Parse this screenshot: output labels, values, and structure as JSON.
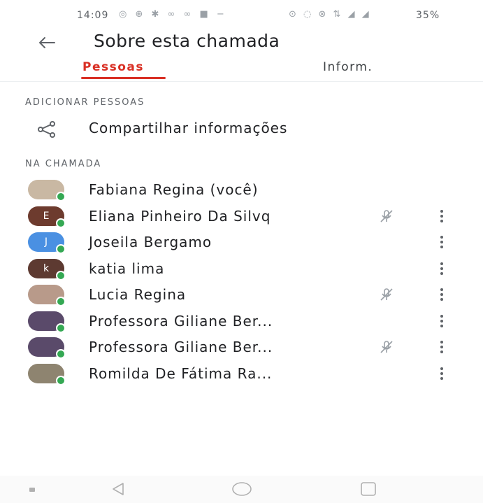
{
  "status_bar": {
    "time": "14:09",
    "left_icons": "◎ ⊕ ✱ ∞ ∞ ■ −",
    "right_icons": "⊙ ◌ ⊗ ⇅ ◢ ◢",
    "battery": "35%"
  },
  "header": {
    "title": "Sobre esta chamada"
  },
  "tabs": [
    {
      "label": "Pessoas",
      "active": true
    },
    {
      "label": "Inform.",
      "active": false
    }
  ],
  "sections": {
    "add_people": "ADICIONAR PESSOAS",
    "in_call": "NA CHAMADA"
  },
  "share": {
    "label": "Compartilhar informações",
    "icon": "share-icon"
  },
  "participants": [
    {
      "name": "Fabiana Regina (você)",
      "avatar_letter": "",
      "avatar_color": "#c9b8a3",
      "muted": false,
      "menu": false
    },
    {
      "name": "Eliana Pinheiro Da Silvq",
      "avatar_letter": "E",
      "avatar_color": "#6d3b2e",
      "muted": true,
      "menu": true
    },
    {
      "name": "Joseila Bergamo",
      "avatar_letter": "J",
      "avatar_color": "#4a90e2",
      "muted": false,
      "menu": true
    },
    {
      "name": "katia lima",
      "avatar_letter": "k",
      "avatar_color": "#5d3a31",
      "muted": false,
      "menu": true
    },
    {
      "name": "Lucia Regina",
      "avatar_letter": "",
      "avatar_color": "#b89a8a",
      "muted": true,
      "menu": true
    },
    {
      "name": "Professora Giliane Ber...",
      "avatar_letter": "",
      "avatar_color": "#5a4a6a",
      "muted": false,
      "menu": true
    },
    {
      "name": "Professora Giliane Ber...",
      "avatar_letter": "",
      "avatar_color": "#5a4a6a",
      "muted": true,
      "menu": true
    },
    {
      "name": "Romilda De Fátima Ra...",
      "avatar_letter": "",
      "avatar_color": "#8e8470",
      "muted": false,
      "menu": true
    }
  ],
  "colors": {
    "accent": "#d93025",
    "online": "#34a853",
    "icon": "#5f6368"
  }
}
